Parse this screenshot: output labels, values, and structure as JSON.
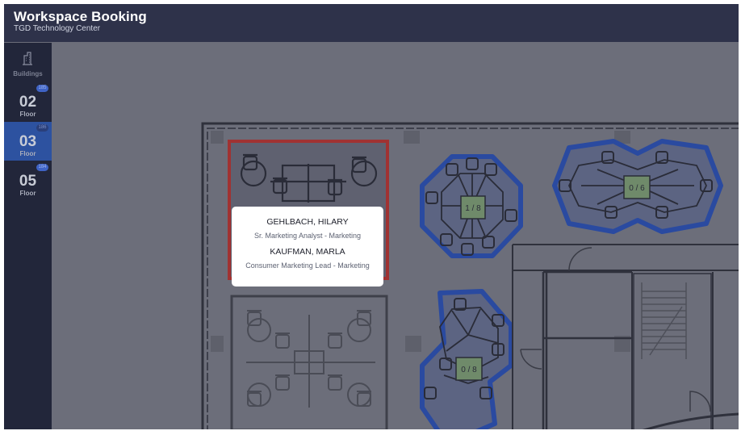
{
  "header": {
    "title": "Workspace Booking",
    "subtitle": "TGD Technology Center"
  },
  "sidebar": {
    "buildings_label": "Buildings",
    "floors": [
      {
        "number": "02",
        "label": "Floor",
        "badge": "185",
        "active": false
      },
      {
        "number": "03",
        "label": "Floor",
        "badge": "186",
        "active": true
      },
      {
        "number": "05",
        "label": "Floor",
        "badge": "184",
        "active": false
      }
    ]
  },
  "map": {
    "pods": [
      {
        "occupancy": "1 / 8"
      },
      {
        "occupancy": "0 / 6"
      },
      {
        "occupancy": "0 / 8"
      }
    ]
  },
  "tooltip": {
    "people": [
      {
        "name": "GEHLBACH, HILARY",
        "role": "Sr. Marketing Analyst - Marketing"
      },
      {
        "name": "KAUFMAN, MARLA",
        "role": "Consumer Marketing Lead - Marketing"
      }
    ]
  },
  "colors": {
    "header": "#2e324a",
    "sidebar": "#22263a",
    "active_floor": "#2d52a0",
    "map_background": "#6c6e7a",
    "pod_outline": "#2a4aa0",
    "selected_outline": "#a03232",
    "occupancy_label_bg": "#6f8a6a"
  },
  "icons": {
    "buildings": "building-icon"
  }
}
